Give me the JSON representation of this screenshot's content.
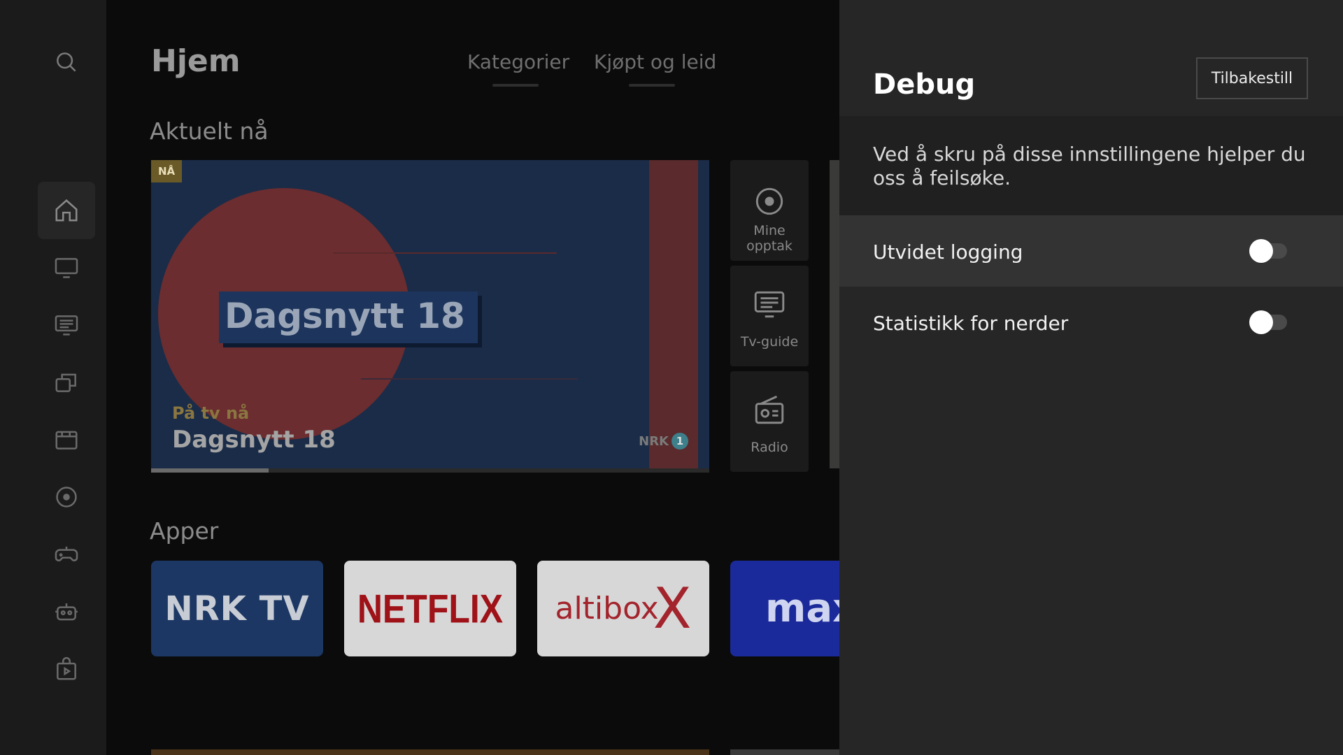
{
  "sidebar": {
    "items": [
      {
        "icon": "search-icon"
      },
      {
        "icon": "home-icon",
        "active": true
      },
      {
        "icon": "tv-icon"
      },
      {
        "icon": "tv-guide-icon"
      },
      {
        "icon": "library-icon"
      },
      {
        "icon": "movie-icon"
      },
      {
        "icon": "recording-icon"
      },
      {
        "icon": "gamepad-icon"
      },
      {
        "icon": "robot-icon"
      },
      {
        "icon": "apps-store-icon"
      }
    ]
  },
  "header": {
    "title": "Hjem",
    "tabs": [
      {
        "label": "Kategorier"
      },
      {
        "label": "Kjøpt og leid"
      }
    ]
  },
  "current": {
    "section_title": "Aktuelt nå",
    "hero": {
      "badge": "NÅ",
      "overlay_title": "Dagsnytt 18",
      "subtitle": "På tv nå",
      "title": "Dagsnytt 18",
      "channel_logo": "NRK",
      "channel_number": "1",
      "progress_fraction": 0.21
    },
    "quick_links": [
      {
        "icon": "record-icon",
        "label": "Mine opptak"
      },
      {
        "icon": "tv-guide-icon",
        "label": "Tv-guide"
      },
      {
        "icon": "radio-icon",
        "label": "Radio"
      }
    ]
  },
  "apps": {
    "section_title": "Apper",
    "items": [
      {
        "label": "NRK TV",
        "bg": "#1c3764",
        "color": "#c8ccd4"
      },
      {
        "label": "NETFLIX",
        "bg": "#d7d7d7",
        "color": "#9e1218"
      },
      {
        "label": "altibox",
        "bg": "#d7d7d7",
        "color": "#a3242c"
      },
      {
        "label": "max",
        "bg": "#1b2a9a",
        "color": "#cfd5f0"
      }
    ]
  },
  "debug": {
    "title": "Debug",
    "reset_label": "Tilbakestill",
    "description": "Ved å skru på disse innstillingene hjelper du oss å feilsøke.",
    "settings": [
      {
        "label": "Utvidet logging",
        "enabled": false
      },
      {
        "label": "Statistikk for nerder",
        "enabled": false
      }
    ]
  },
  "colors": {
    "panel_bg": "#262626",
    "focus_row": "#333333",
    "main_dim_bg": "#0b0b0b"
  }
}
